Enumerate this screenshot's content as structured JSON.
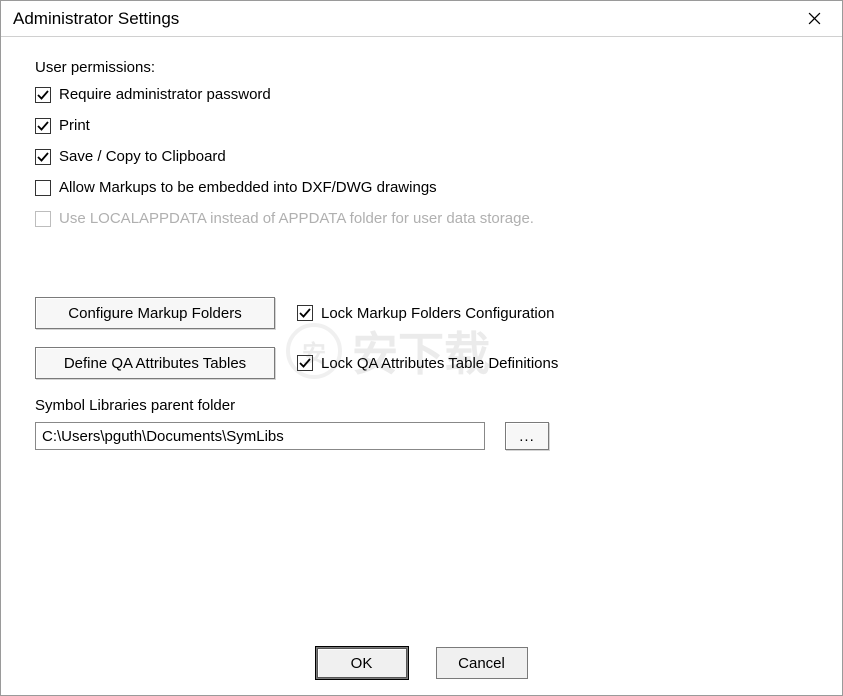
{
  "title": "Administrator Settings",
  "section_label": "User permissions:",
  "checkboxes": {
    "require_password": {
      "label": "Require administrator password",
      "checked": true,
      "disabled": false
    },
    "print": {
      "label": "Print",
      "checked": true,
      "disabled": false
    },
    "save_copy": {
      "label": "Save / Copy to Clipboard",
      "checked": true,
      "disabled": false
    },
    "allow_markups": {
      "label": "Allow Markups to be embedded into DXF/DWG drawings",
      "checked": false,
      "disabled": false
    },
    "use_localappdata": {
      "label": "Use LOCALAPPDATA instead of APPDATA folder for user data storage.",
      "checked": false,
      "disabled": true
    },
    "lock_markup": {
      "label": "Lock Markup Folders Configuration",
      "checked": true,
      "disabled": false
    },
    "lock_qa": {
      "label": "Lock QA Attributes Table Definitions",
      "checked": true,
      "disabled": false
    }
  },
  "buttons": {
    "configure_markup": "Configure Markup Folders",
    "define_qa": "Define QA Attributes Tables",
    "browse": "...",
    "ok": "OK",
    "cancel": "Cancel"
  },
  "path": {
    "label": "Symbol Libraries parent folder",
    "value": "C:\\Users\\pguth\\Documents\\SymLibs"
  }
}
